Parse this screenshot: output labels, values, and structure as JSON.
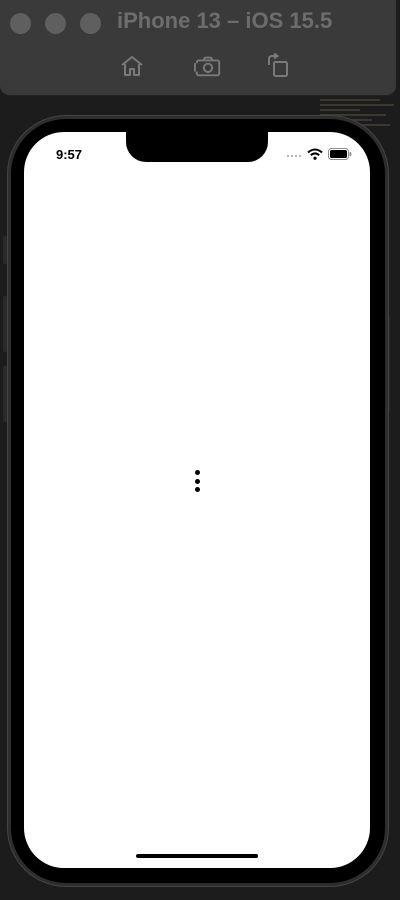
{
  "window": {
    "title": "iPhone 13 – iOS 15.5",
    "toolbar": {
      "home_icon": "home-icon",
      "screenshot_icon": "camera-icon",
      "rotate_icon": "rotate-icon"
    }
  },
  "device": {
    "status_bar": {
      "time": "9:57",
      "signal_icon": "cellular-signal-icon",
      "wifi_icon": "wifi-icon",
      "battery_icon": "battery-icon"
    },
    "content": {
      "menu_icon": "more-vertical-icon"
    }
  },
  "colors": {
    "chrome": "#3a3a3a",
    "title_text": "#6d6d6d",
    "screen_bg": "#ffffff"
  }
}
